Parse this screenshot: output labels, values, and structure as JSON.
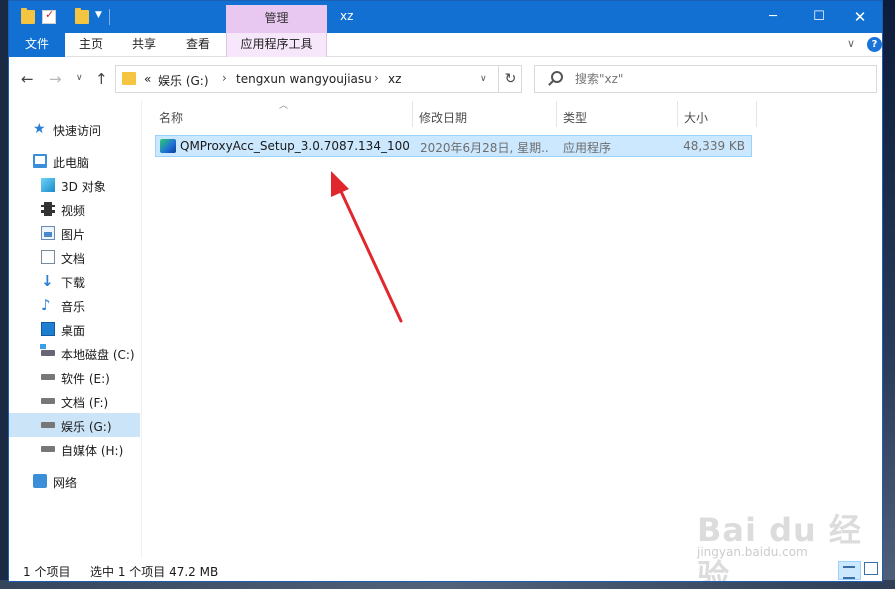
{
  "window": {
    "title": "xz",
    "context_tab_header": "管理",
    "minimize_glyph": "─",
    "maximize_glyph": "☐",
    "close_glyph": "✕"
  },
  "ribbon": {
    "tabs": [
      "文件",
      "主页",
      "共享",
      "查看",
      "应用程序工具"
    ],
    "expand_glyph": "∨",
    "help_glyph": "?"
  },
  "nav": {
    "back_glyph": "←",
    "forward_glyph": "→",
    "recent_glyph": "∨",
    "up_glyph": "↑",
    "refresh_glyph": "↻",
    "dropdown_glyph": "∨"
  },
  "address": {
    "overflow": "«",
    "crumbs": [
      "娱乐 (G:)",
      "tengxun wangyoujiasu",
      "xz"
    ],
    "separator": "›"
  },
  "search": {
    "placeholder": "搜索\"xz\""
  },
  "navpane": {
    "items": [
      {
        "label": "快速访问",
        "icon": "star-icon"
      },
      {
        "label": "此电脑",
        "icon": "computer-icon"
      },
      {
        "label": "3D 对象",
        "icon": "cube-icon"
      },
      {
        "label": "视频",
        "icon": "film-icon"
      },
      {
        "label": "图片",
        "icon": "picture-icon"
      },
      {
        "label": "文档",
        "icon": "document-icon"
      },
      {
        "label": "下载",
        "icon": "download-icon"
      },
      {
        "label": "音乐",
        "icon": "music-icon"
      },
      {
        "label": "桌面",
        "icon": "desktop-icon"
      },
      {
        "label": "本地磁盘 (C:)",
        "icon": "system-drive-icon"
      },
      {
        "label": "软件 (E:)",
        "icon": "drive-icon"
      },
      {
        "label": "文档 (F:)",
        "icon": "drive-icon"
      },
      {
        "label": "娱乐 (G:)",
        "icon": "drive-icon"
      },
      {
        "label": "自媒体 (H:)",
        "icon": "drive-icon"
      },
      {
        "label": "网络",
        "icon": "network-icon"
      }
    ]
  },
  "columns": {
    "name": "名称",
    "date": "修改日期",
    "type": "类型",
    "size": "大小"
  },
  "files": [
    {
      "name": "QMProxyAcc_Setup_3.0.7087.134_100...",
      "date": "2020年6月28日, 星期...",
      "type": "应用程序",
      "size": "48,339 KB",
      "icon": "qmproxyacc-app-icon"
    }
  ],
  "status": {
    "count": "1 个项目",
    "selected": "选中 1 个项目  47.2 MB"
  },
  "watermark": {
    "brand": "Bai du 经验",
    "sub": "jingyan.baidu.com"
  },
  "colors": {
    "accent": "#1170d1",
    "context_tab": "#e8c8f0",
    "selection": "#cce8ff",
    "annotation_arrow": "#e0272e"
  }
}
